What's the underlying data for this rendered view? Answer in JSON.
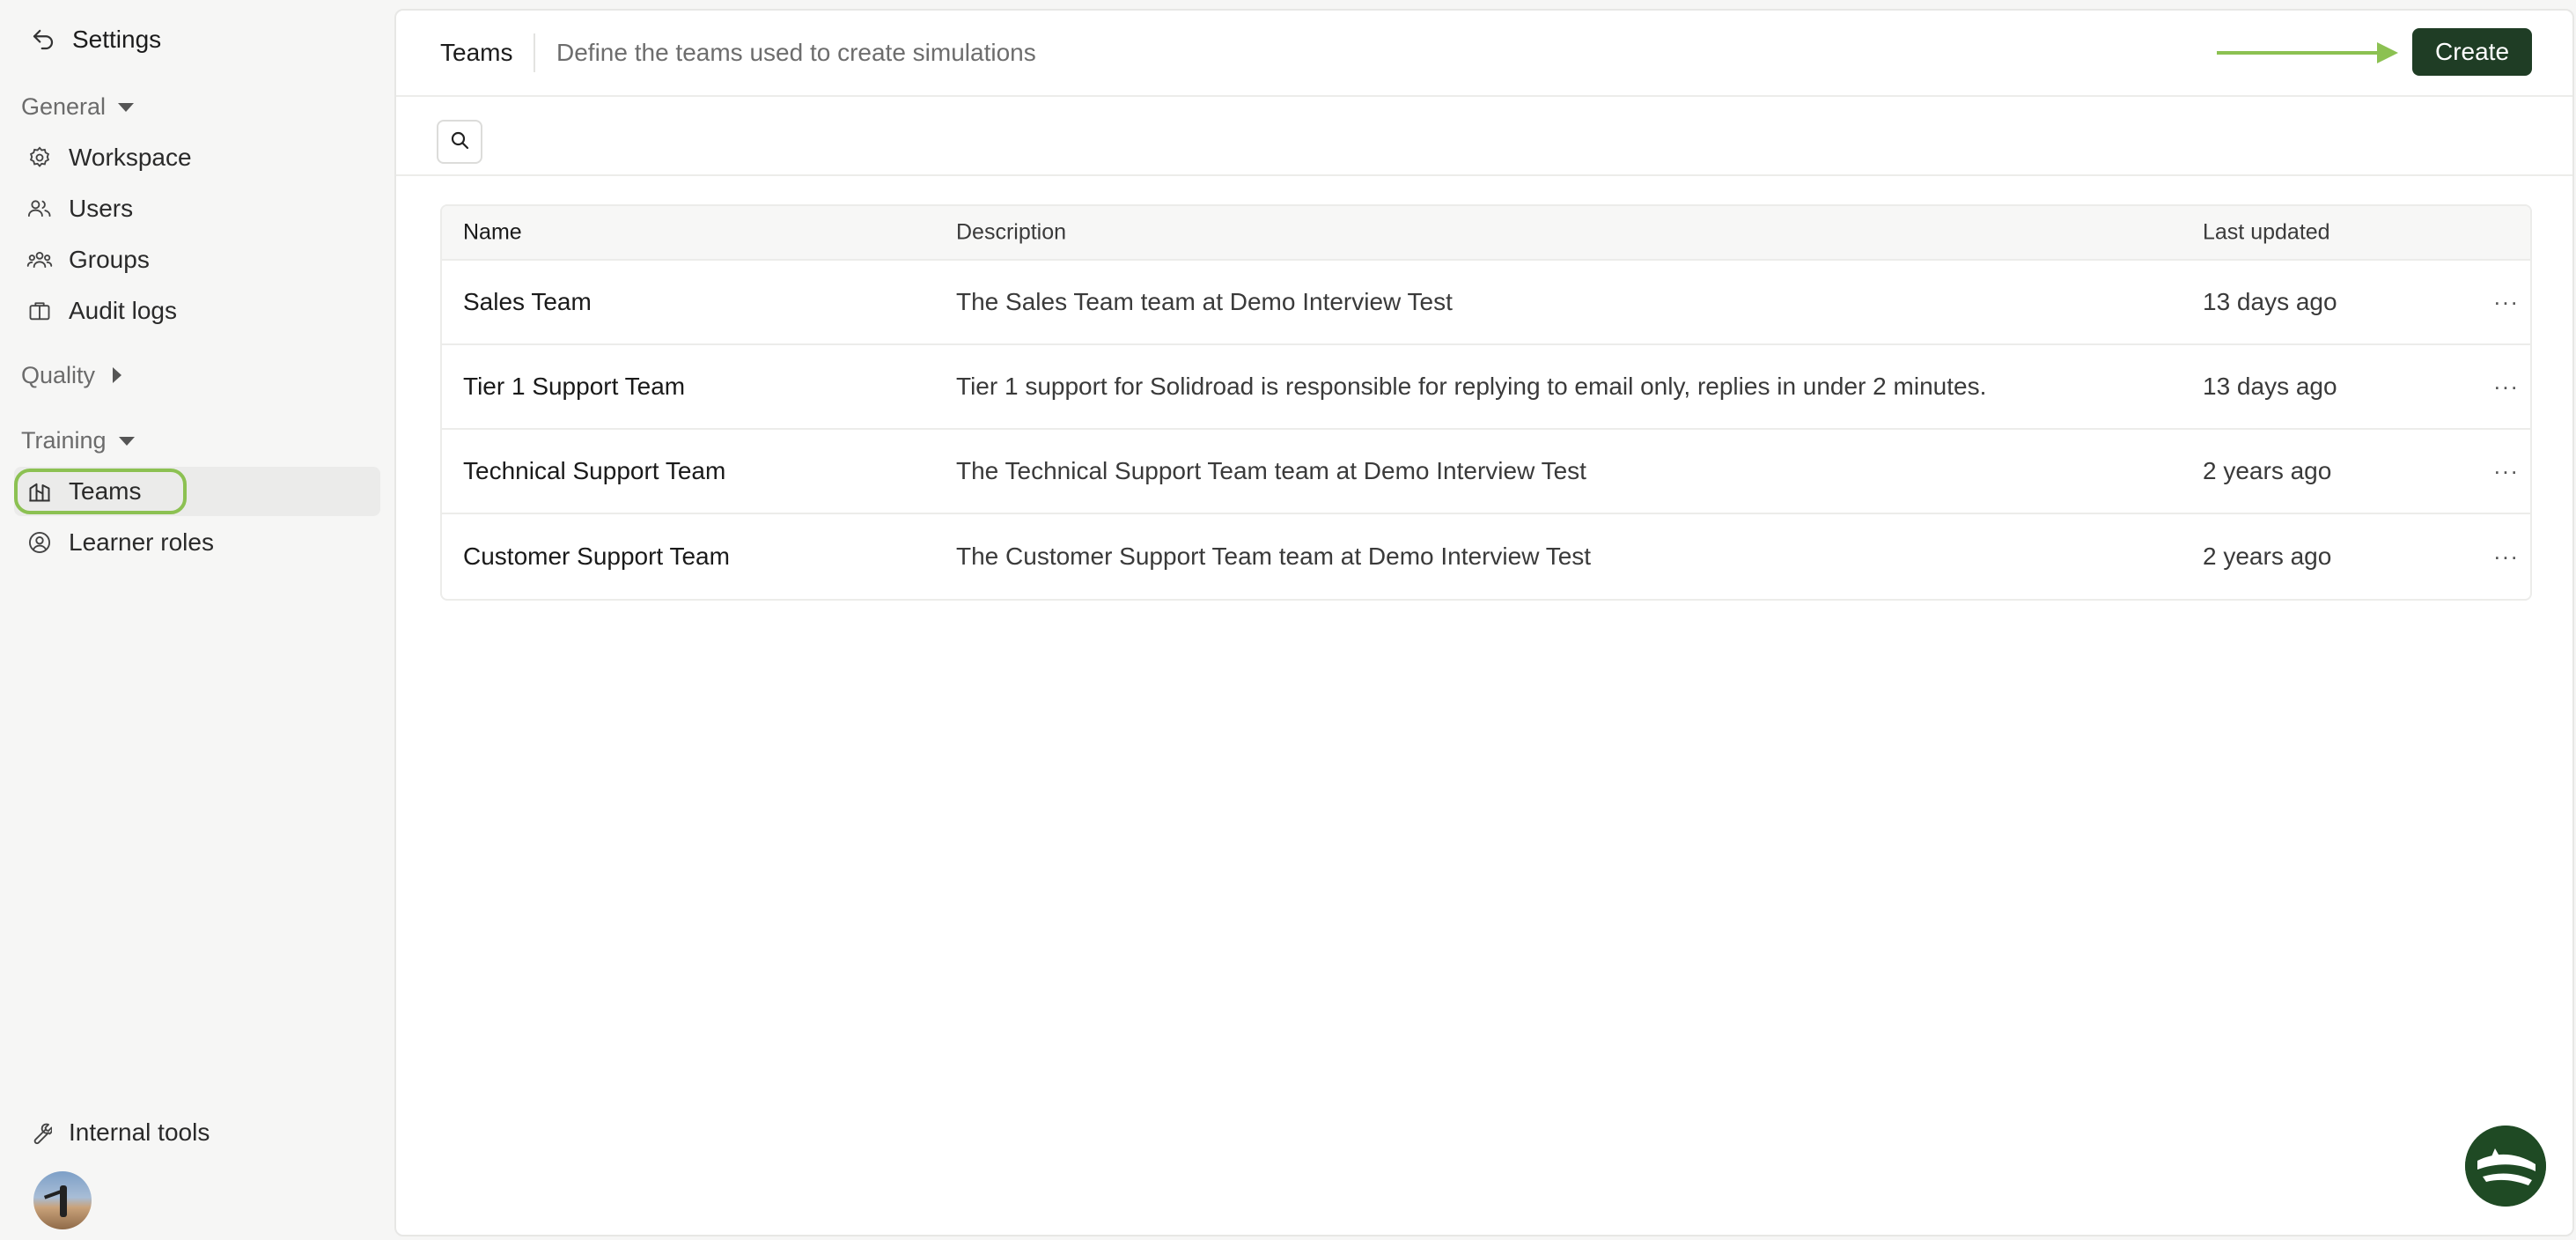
{
  "sidebar": {
    "title": "Settings",
    "sections": {
      "general": "General",
      "quality": "Quality",
      "training": "Training"
    },
    "items": {
      "workspace": "Workspace",
      "users": "Users",
      "groups": "Groups",
      "audit_logs": "Audit logs",
      "teams": "Teams",
      "learner_roles": "Learner roles",
      "internal_tools": "Internal tools"
    },
    "active_item": "Teams"
  },
  "header": {
    "title": "Teams",
    "subtitle": "Define the teams used to create simulations",
    "create_label": "Create"
  },
  "table": {
    "columns": [
      "Name",
      "Description",
      "Last updated"
    ],
    "rows": [
      {
        "name": "Sales Team",
        "description": "The Sales Team team at Demo Interview Test",
        "updated": "13 days ago"
      },
      {
        "name": "Tier 1 Support Team",
        "description": "Tier 1 support for Solidroad is responsible for replying to email only, replies in under 2 minutes.",
        "updated": "13 days ago"
      },
      {
        "name": "Technical Support Team",
        "description": "The Technical Support Team team at Demo Interview Test",
        "updated": "2 years ago"
      },
      {
        "name": "Customer Support Team",
        "description": "The Customer Support Team team at Demo Interview Test",
        "updated": "2 years ago"
      }
    ],
    "row_action_icon": "more-horizontal-icon"
  },
  "colors": {
    "accent": "#1f3d25",
    "highlight": "#8cc152"
  }
}
